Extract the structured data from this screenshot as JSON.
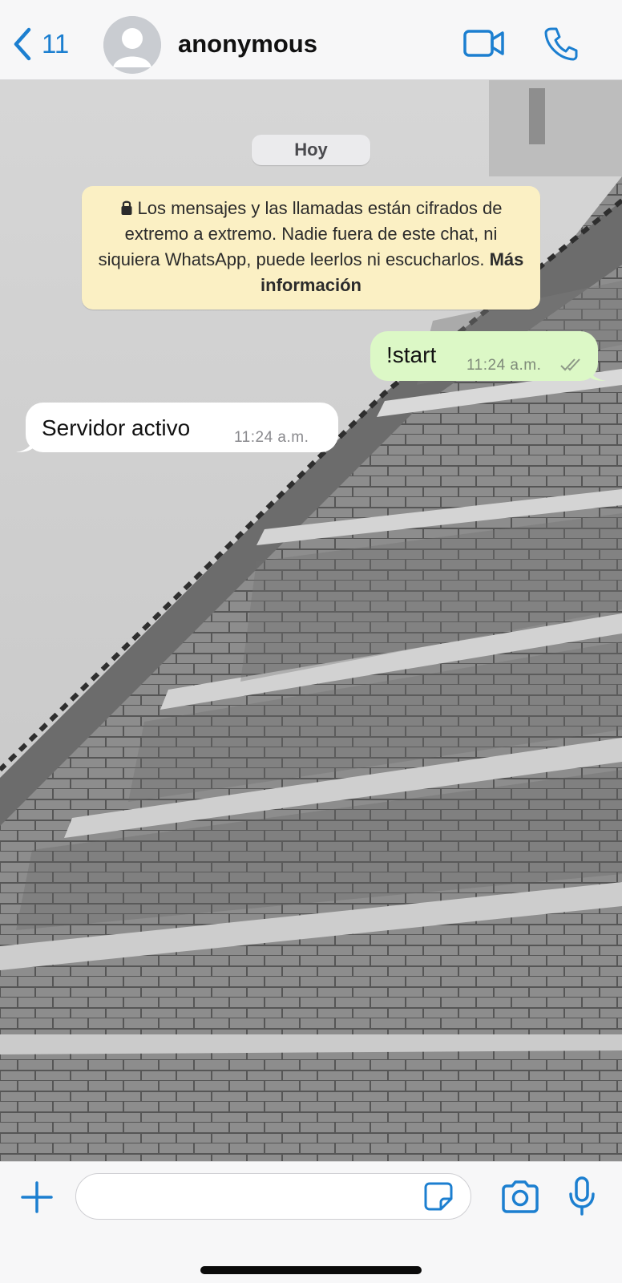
{
  "header": {
    "back_count": "11",
    "contact_name": "anonymous",
    "icons": {
      "back": "chevron-left-icon",
      "video": "video-camera-icon",
      "call": "phone-icon",
      "avatar": "default-avatar-icon"
    }
  },
  "chat": {
    "date_label": "Hoy",
    "encryption_notice": {
      "text": "Los mensajes y las llamadas están cifrados de extremo a extremo. Nadie fuera de este chat, ni siquiera WhatsApp, puede leerlos ni escucharlos.",
      "link": "Más información"
    },
    "messages": [
      {
        "direction": "outgoing",
        "text": "!start",
        "time": "11:24 a.m.",
        "status": "read"
      },
      {
        "direction": "incoming",
        "text": "Servidor activo",
        "time": "11:24 a.m."
      }
    ]
  },
  "composer": {
    "placeholder": "",
    "icons": {
      "attach": "plus-icon",
      "sticker": "sticker-icon",
      "camera": "camera-icon",
      "mic": "microphone-icon"
    }
  },
  "colors": {
    "accent": "#1c7fd0",
    "outgoing_bubble": "#dcf8c6",
    "incoming_bubble": "#ffffff",
    "notice_bg": "#fbf0c4"
  }
}
